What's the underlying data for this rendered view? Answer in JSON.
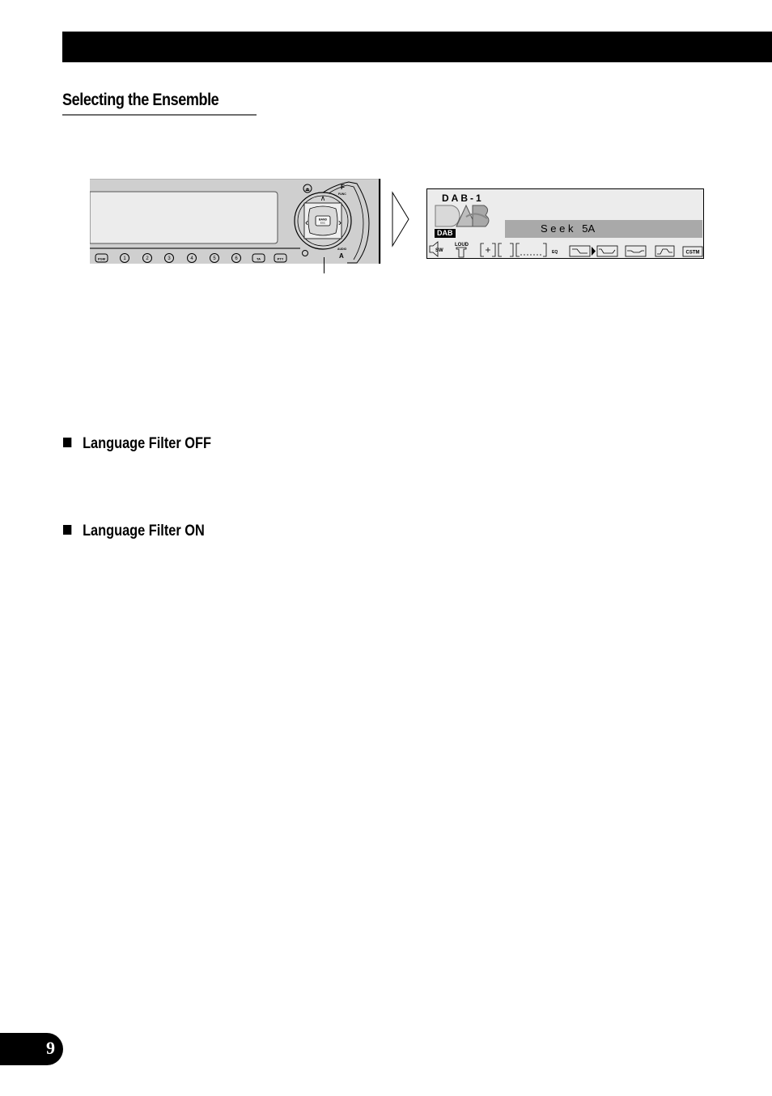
{
  "page": {
    "section_title": "Selecting the Ensemble",
    "subsections": [
      {
        "label": "Language Filter OFF"
      },
      {
        "label": "Language Filter ON"
      }
    ],
    "page_number": "9"
  },
  "head_unit": {
    "preset_buttons": [
      "PGM",
      "1",
      "2",
      "3",
      "4",
      "5",
      "6",
      "TA",
      "PTY"
    ],
    "eject_label": "⏏",
    "func_button": {
      "letter": "F",
      "label": "FUNC"
    },
    "audio_button": {
      "label": "AUDIO",
      "letter": "A"
    },
    "center_button": {
      "line1": "BAND",
      "line2": "ESC"
    },
    "joystick_up": "∧",
    "joystick_left": "‹",
    "joystick_right": "›"
  },
  "lcd": {
    "band": "DAB-1",
    "logo_text": "DAB",
    "badge": "DAB",
    "status_text": "S e e k   5A",
    "indicators": {
      "subwoofer": "SW",
      "loudness": "LOUD",
      "eq": "EQ",
      "custom": "CSTM"
    },
    "selected_eq_index": 1,
    "eq_presets": [
      "eq-curve-1",
      "eq-curve-2",
      "eq-curve-3",
      "eq-curve-4"
    ]
  }
}
